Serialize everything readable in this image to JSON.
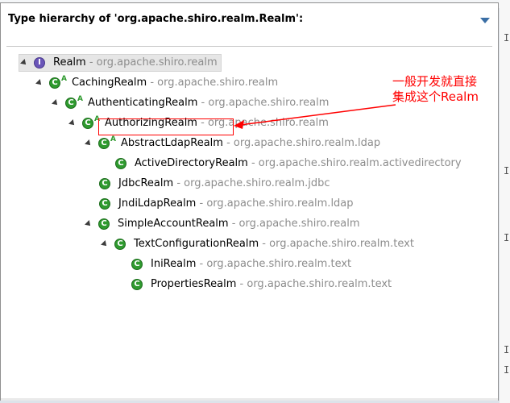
{
  "window": {
    "title": "Type hierarchy of 'org.apache.shiro.realm.Realm':"
  },
  "tree": [
    {
      "name": "Realm",
      "sep": " - ",
      "pkg": "org.apache.shiro.realm",
      "kind": "interface",
      "abstract": false,
      "expanded": true
    },
    {
      "name": "CachingRealm",
      "sep": " - ",
      "pkg": "org.apache.shiro.realm",
      "kind": "class",
      "abstract": true,
      "expanded": true
    },
    {
      "name": "AuthenticatingRealm",
      "sep": " - ",
      "pkg": "org.apache.shiro.realm",
      "kind": "class",
      "abstract": true,
      "expanded": true
    },
    {
      "name": "AuthorizingRealm",
      "sep": " - ",
      "pkg": "org.apache.shiro.realm",
      "kind": "class",
      "abstract": true,
      "expanded": true
    },
    {
      "name": "AbstractLdapRealm",
      "sep": " - ",
      "pkg": "org.apache.shiro.realm.ldap",
      "kind": "class",
      "abstract": true,
      "expanded": true
    },
    {
      "name": "ActiveDirectoryRealm",
      "sep": " - ",
      "pkg": "org.apache.shiro.realm.activedirectory",
      "kind": "class",
      "abstract": false,
      "expanded": false
    },
    {
      "name": "JdbcRealm",
      "sep": " - ",
      "pkg": "org.apache.shiro.realm.jdbc",
      "kind": "class",
      "abstract": false,
      "expanded": false
    },
    {
      "name": "JndiLdapRealm",
      "sep": " - ",
      "pkg": "org.apache.shiro.realm.ldap",
      "kind": "class",
      "abstract": false,
      "expanded": false
    },
    {
      "name": "SimpleAccountRealm",
      "sep": " - ",
      "pkg": "org.apache.shiro.realm",
      "kind": "class",
      "abstract": false,
      "expanded": true
    },
    {
      "name": "TextConfigurationRealm",
      "sep": " - ",
      "pkg": "org.apache.shiro.realm.text",
      "kind": "class",
      "abstract": false,
      "expanded": true
    },
    {
      "name": "IniRealm",
      "sep": " - ",
      "pkg": "org.apache.shiro.realm.text",
      "kind": "class",
      "abstract": false,
      "expanded": false
    },
    {
      "name": "PropertiesRealm",
      "sep": " - ",
      "pkg": "org.apache.shiro.realm.text",
      "kind": "class",
      "abstract": false,
      "expanded": false
    }
  ],
  "annotation": {
    "line1": "一般开发就直接",
    "line2": "集成这个Realm",
    "color": "#ff0000"
  },
  "background_marks": [
    "I",
    "I",
    "I",
    "I",
    "I"
  ],
  "icons": {
    "interface": "interface-icon",
    "class": "class-icon",
    "menu": "view-menu-icon",
    "twisty": "expand-triangle-icon"
  }
}
